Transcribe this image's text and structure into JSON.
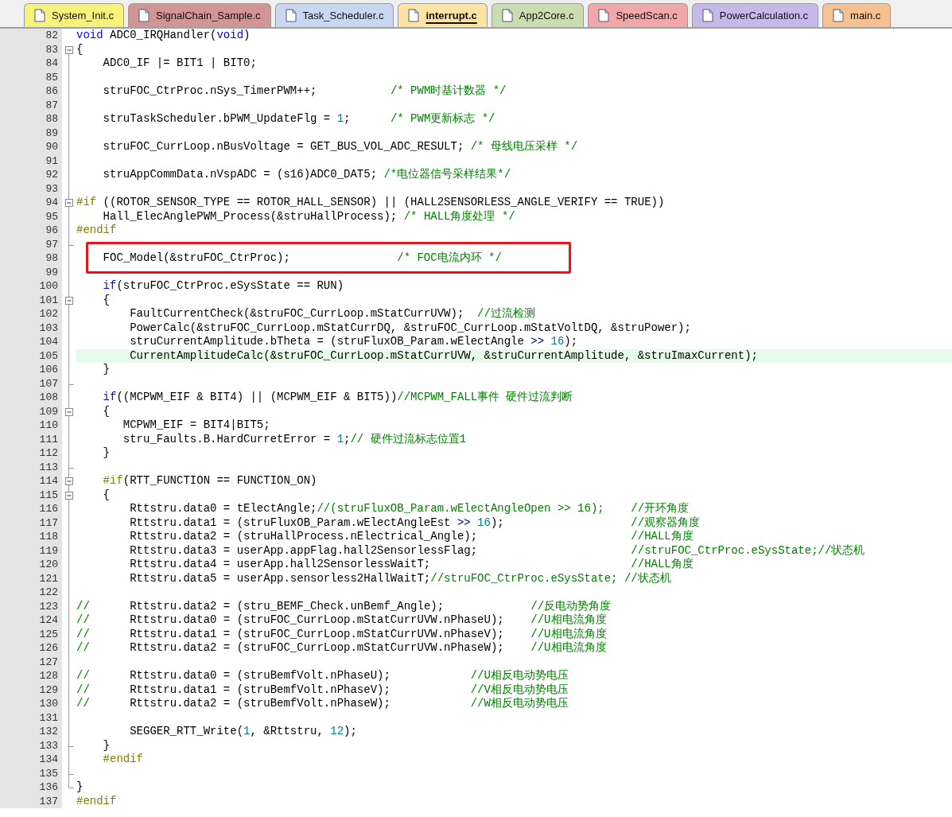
{
  "tabs": [
    {
      "label": "System_Init.c",
      "color": "#f7f27c",
      "selected": false
    },
    {
      "label": "SignalChain_Sample.c",
      "color": "#d29494",
      "selected": false
    },
    {
      "label": "Task_Scheduler.c",
      "color": "#c9d8f2",
      "selected": false
    },
    {
      "label": "interrupt.c",
      "color": "#fde4a4",
      "selected": true
    },
    {
      "label": "App2Core.c",
      "color": "#c9ddb0",
      "selected": false
    },
    {
      "label": "SpeedScan.c",
      "color": "#f2a8a8",
      "selected": false
    },
    {
      "label": "PowerCalculation.c",
      "color": "#c6b8ea",
      "selected": false
    },
    {
      "label": "main.c",
      "color": "#f8c290",
      "selected": false
    }
  ],
  "editor": {
    "lines": [
      {
        "number": "82",
        "segments": [
          {
            "kind": "keyword",
            "text": "void"
          },
          {
            "kind": "code",
            "text": " ADC0_IRQHandler("
          },
          {
            "kind": "keyword",
            "text": "void"
          },
          {
            "kind": "code",
            "text": ")"
          }
        ]
      },
      {
        "number": "83",
        "fold_start": true,
        "segments": [
          {
            "kind": "code",
            "text": "{"
          }
        ]
      },
      {
        "number": "84",
        "segments": [
          {
            "kind": "code",
            "text": "    ADC0_IF |= BIT1 | BIT0;"
          }
        ]
      },
      {
        "number": "85"
      },
      {
        "number": "86",
        "segments": [
          {
            "kind": "code",
            "text": "    struFOC_CtrProc.nSys_TimerPWM++;           "
          },
          {
            "kind": "comment",
            "text": "/* PWM时基计数器 */"
          }
        ]
      },
      {
        "number": "87"
      },
      {
        "number": "88",
        "segments": [
          {
            "kind": "code",
            "text": "    struTaskScheduler.bPWM_UpdateFlg = "
          },
          {
            "kind": "number",
            "text": "1"
          },
          {
            "kind": "code",
            "text": ";      "
          },
          {
            "kind": "comment",
            "text": "/* PWM更新标志 */"
          }
        ]
      },
      {
        "number": "89"
      },
      {
        "number": "90",
        "segments": [
          {
            "kind": "code",
            "text": "    struFOC_CurrLoop.nBusVoltage = GET_BUS_VOL_ADC_RESULT; "
          },
          {
            "kind": "comment",
            "text": "/* 母线电压采样 */"
          }
        ]
      },
      {
        "number": "91"
      },
      {
        "number": "92",
        "segments": [
          {
            "kind": "code",
            "text": "    struAppCommData.nVspADC = (s16)ADC0_DAT5; "
          },
          {
            "kind": "comment",
            "text": "/*电位器信号采样结果*/"
          }
        ]
      },
      {
        "number": "93"
      },
      {
        "number": "94",
        "fold_start": true,
        "segments": [
          {
            "kind": "preprocessor",
            "text": "#if"
          },
          {
            "kind": "code",
            "text": " ((ROTOR_SENSOR_TYPE == ROTOR_HALL_SENSOR) || (HALL2SENSORLESS_ANGLE_VERIFY == TRUE))"
          }
        ]
      },
      {
        "number": "95",
        "segments": [
          {
            "kind": "code",
            "text": "    Hall_ElecAnglePWM_Process(&struHallProcess); "
          },
          {
            "kind": "comment",
            "text": "/* HALL角度处理 */"
          }
        ]
      },
      {
        "number": "96",
        "segments": [
          {
            "kind": "preprocessor",
            "text": "#endif"
          }
        ]
      },
      {
        "number": "97",
        "fold_end": true
      },
      {
        "number": "98",
        "boxed": true,
        "segments": [
          {
            "kind": "code",
            "text": "    FOC_Model(&struFOC_CtrProc);                "
          },
          {
            "kind": "comment",
            "text": "/* FOC电流内环 */"
          }
        ]
      },
      {
        "number": "99"
      },
      {
        "number": "100",
        "segments": [
          {
            "kind": "keyword",
            "text": "    if"
          },
          {
            "kind": "code",
            "text": "(struFOC_CtrProc.eSysState == RUN)"
          }
        ]
      },
      {
        "number": "101",
        "fold_start": true,
        "segments": [
          {
            "kind": "code",
            "text": "    {"
          }
        ]
      },
      {
        "number": "102",
        "segments": [
          {
            "kind": "code",
            "text": "        FaultCurrentCheck(&struFOC_CurrLoop.mStatCurrUVW);  "
          },
          {
            "kind": "comment",
            "text": "//过流检测"
          }
        ]
      },
      {
        "number": "103",
        "segments": [
          {
            "kind": "code",
            "text": "        PowerCalc(&struFOC_CurrLoop.mStatCurrDQ, &struFOC_CurrLoop.mStatVoltDQ, &struPower);"
          }
        ]
      },
      {
        "number": "104",
        "segments": [
          {
            "kind": "code",
            "text": "        struCurrentAmplitude.bTheta = (struFluxOB_Param.wElectAngle "
          },
          {
            "kind": "operator",
            "text": ">> "
          },
          {
            "kind": "number",
            "text": "16"
          },
          {
            "kind": "code",
            "text": ");"
          }
        ]
      },
      {
        "number": "105",
        "current": true,
        "segments": [
          {
            "kind": "code",
            "text": "        CurrentAmplitudeCalc(&struFOC_CurrLoop.mStatCurrUVW, &struCurrentAmplitude, &struImaxCurrent);"
          }
        ]
      },
      {
        "number": "106",
        "segments": [
          {
            "kind": "code",
            "text": "    }"
          }
        ]
      },
      {
        "number": "107",
        "fold_end": true
      },
      {
        "number": "108",
        "segments": [
          {
            "kind": "keyword",
            "text": "    if"
          },
          {
            "kind": "code",
            "text": "((MCPWM_EIF & BIT4) || (MCPWM_EIF & BIT5))"
          },
          {
            "kind": "comment",
            "text": "//MCPWM_FALL事件 硬件过流判断"
          }
        ]
      },
      {
        "number": "109",
        "fold_start": true,
        "segments": [
          {
            "kind": "code",
            "text": "    {"
          }
        ]
      },
      {
        "number": "110",
        "segments": [
          {
            "kind": "code",
            "text": "       MCPWM_EIF = BIT4|BIT5;"
          }
        ]
      },
      {
        "number": "111",
        "segments": [
          {
            "kind": "code",
            "text": "       stru_Faults.B.HardCurretError = "
          },
          {
            "kind": "number",
            "text": "1"
          },
          {
            "kind": "code",
            "text": ";"
          },
          {
            "kind": "comment",
            "text": "// 硬件过流标志位置1"
          }
        ]
      },
      {
        "number": "112",
        "segments": [
          {
            "kind": "code",
            "text": "    }"
          }
        ]
      },
      {
        "number": "113",
        "fold_end": true
      },
      {
        "number": "114",
        "fold_start": true,
        "segments": [
          {
            "kind": "preprocessor",
            "text": "    #if"
          },
          {
            "kind": "code",
            "text": "(RTT_FUNCTION == FUNCTION_ON)"
          }
        ]
      },
      {
        "number": "115",
        "fold_start": true,
        "segments": [
          {
            "kind": "code",
            "text": "    {"
          }
        ]
      },
      {
        "number": "116",
        "segments": [
          {
            "kind": "code",
            "text": "        Rttstru.data0 = tElectAngle;"
          },
          {
            "kind": "comment",
            "text": "//(struFluxOB_Param.wElectAngleOpen >> 16);    //开环角度"
          }
        ]
      },
      {
        "number": "117",
        "segments": [
          {
            "kind": "code",
            "text": "        Rttstru.data1 = (struFluxOB_Param.wElectAngleEst "
          },
          {
            "kind": "operator",
            "text": ">> "
          },
          {
            "kind": "number",
            "text": "16"
          },
          {
            "kind": "code",
            "text": ");                   "
          },
          {
            "kind": "comment",
            "text": "//观察器角度"
          }
        ]
      },
      {
        "number": "118",
        "segments": [
          {
            "kind": "code",
            "text": "        Rttstru.data2 = (struHallProcess.nElectrical_Angle);                       "
          },
          {
            "kind": "comment",
            "text": "//HALL角度"
          }
        ]
      },
      {
        "number": "119",
        "segments": [
          {
            "kind": "code",
            "text": "        Rttstru.data3 = userApp.appFlag.hall2SensorlessFlag;                       "
          },
          {
            "kind": "comment",
            "text": "//struFOC_CtrProc.eSysState;//状态机"
          }
        ]
      },
      {
        "number": "120",
        "segments": [
          {
            "kind": "code",
            "text": "        Rttstru.data4 = userApp.hall2SensorlessWaitT;                              "
          },
          {
            "kind": "comment",
            "text": "//HALL角度"
          }
        ]
      },
      {
        "number": "121",
        "segments": [
          {
            "kind": "code",
            "text": "        Rttstru.data5 = userApp.sensorless2HallWaitT;"
          },
          {
            "kind": "comment",
            "text": "//struFOC_CtrProc.eSysState; //状态机"
          }
        ]
      },
      {
        "number": "122"
      },
      {
        "number": "123",
        "segments": [
          {
            "kind": "comment",
            "text": "//"
          },
          {
            "kind": "code",
            "text": "      Rttstru.data2 = (stru_BEMF_Check.unBemf_Angle);             "
          },
          {
            "kind": "comment",
            "text": "//反电动势角度"
          }
        ]
      },
      {
        "number": "124",
        "segments": [
          {
            "kind": "comment",
            "text": "//"
          },
          {
            "kind": "code",
            "text": "      Rttstru.data0 = (struFOC_CurrLoop.mStatCurrUVW.nPhaseU);    "
          },
          {
            "kind": "comment",
            "text": "//U相电流角度"
          }
        ]
      },
      {
        "number": "125",
        "segments": [
          {
            "kind": "comment",
            "text": "//"
          },
          {
            "kind": "code",
            "text": "      Rttstru.data1 = (struFOC_CurrLoop.mStatCurrUVW.nPhaseV);    "
          },
          {
            "kind": "comment",
            "text": "//U相电流角度"
          }
        ]
      },
      {
        "number": "126",
        "segments": [
          {
            "kind": "comment",
            "text": "//"
          },
          {
            "kind": "code",
            "text": "      Rttstru.data2 = (struFOC_CurrLoop.mStatCurrUVW.nPhaseW);    "
          },
          {
            "kind": "comment",
            "text": "//U相电流角度"
          }
        ]
      },
      {
        "number": "127"
      },
      {
        "number": "128",
        "segments": [
          {
            "kind": "comment",
            "text": "//"
          },
          {
            "kind": "code",
            "text": "      Rttstru.data0 = (struBemfVolt.nPhaseU);            "
          },
          {
            "kind": "comment",
            "text": "//U相反电动势电压"
          }
        ]
      },
      {
        "number": "129",
        "segments": [
          {
            "kind": "comment",
            "text": "//"
          },
          {
            "kind": "code",
            "text": "      Rttstru.data1 = (struBemfVolt.nPhaseV);            "
          },
          {
            "kind": "comment",
            "text": "//V相反电动势电压"
          }
        ]
      },
      {
        "number": "130",
        "segments": [
          {
            "kind": "comment",
            "text": "//"
          },
          {
            "kind": "code",
            "text": "      Rttstru.data2 = (struBemfVolt.nPhaseW);            "
          },
          {
            "kind": "comment",
            "text": "//W相反电动势电压"
          }
        ]
      },
      {
        "number": "131"
      },
      {
        "number": "132",
        "segments": [
          {
            "kind": "code",
            "text": "        SEGGER_RTT_Write("
          },
          {
            "kind": "number",
            "text": "1"
          },
          {
            "kind": "code",
            "text": ", &Rttstru, "
          },
          {
            "kind": "number",
            "text": "12"
          },
          {
            "kind": "code",
            "text": ");"
          }
        ]
      },
      {
        "number": "133",
        "fold_end": true,
        "segments": [
          {
            "kind": "code",
            "text": "    }"
          }
        ]
      },
      {
        "number": "134",
        "segments": [
          {
            "kind": "preprocessor",
            "text": "    #endif"
          }
        ]
      },
      {
        "number": "135",
        "fold_end": true
      },
      {
        "number": "136",
        "fold_end": true,
        "segments": [
          {
            "kind": "code",
            "text": "}"
          }
        ]
      },
      {
        "number": "137",
        "segments": [
          {
            "kind": "preprocessor",
            "text": "#endif"
          }
        ]
      }
    ]
  }
}
